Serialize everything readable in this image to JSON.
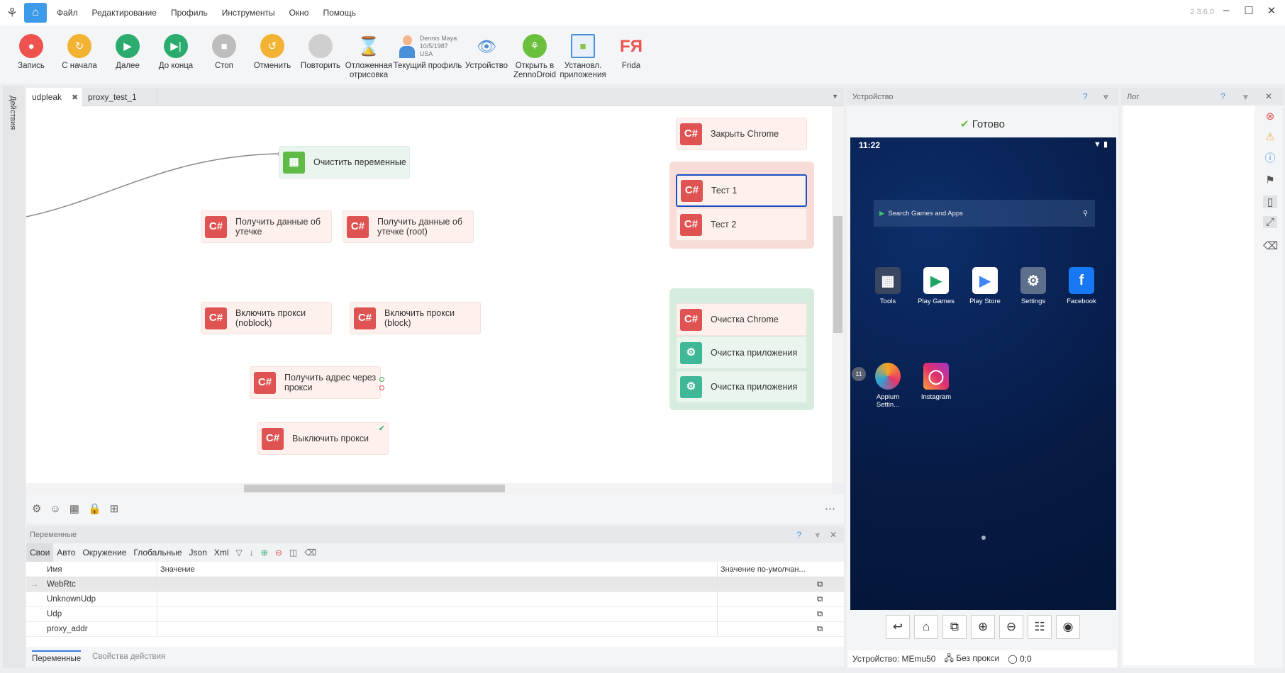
{
  "app": {
    "version": "2.3.6.0"
  },
  "menu": [
    "Файл",
    "Редактирование",
    "Профиль",
    "Инструменты",
    "Окно",
    "Помощь"
  ],
  "toolbar": [
    {
      "label": "Запись",
      "icon": "record-icon",
      "color": "#ef5350"
    },
    {
      "label": "С начала",
      "icon": "restart-icon",
      "color": "#f2b233"
    },
    {
      "label": "Далее",
      "icon": "play-icon",
      "color": "#2bab6e"
    },
    {
      "label": "До конца",
      "icon": "play-to-end-icon",
      "color": "#2bab6e"
    },
    {
      "label": "Стоп",
      "icon": "stop-icon",
      "color": "#bdbdbd"
    },
    {
      "label": "Отменить",
      "icon": "undo-icon",
      "color": "#f2b233"
    },
    {
      "label": "Повторить",
      "icon": "redo-icon",
      "color": "#cfcfcf"
    },
    {
      "label": "Отложенная отрисовка",
      "icon": "hourglass-icon",
      "color": "#b07a3c"
    },
    {
      "label": "Устройство",
      "icon": "eye-icon",
      "color": "#4a90d9"
    },
    {
      "label": "Открыть в ZennoDroid",
      "icon": "zennodroid-icon",
      "color": "#6abf3c"
    },
    {
      "label": "Установл. приложения",
      "icon": "installed-apps-icon",
      "color": "#4a90d9"
    },
    {
      "label": "Frida",
      "icon": "frida-logo",
      "color": "#ef5350"
    }
  ],
  "profile": {
    "label": "Текущий профиль",
    "name": "Dennis Maya",
    "dob": "10/5/1987",
    "country": "USA"
  },
  "side_strip": "Действия",
  "tabs": [
    {
      "label": "udpleak",
      "active": true
    },
    {
      "label": "proxy_test_1",
      "active": false
    }
  ],
  "nodes": {
    "clear_vars": "Очистить переменные",
    "leak": "Получить данные об утечке",
    "leak_root": "Получить данные об утечке (root)",
    "proxy_noblock": "Включить прокси (noblock)",
    "proxy_block": "Включить прокси (block)",
    "get_addr": "Получить адрес через прокси",
    "proxy_off": "Выключить прокси",
    "close_chrome": "Закрыть Chrome",
    "test1": "Тест 1",
    "test2": "Тест 2",
    "clear_chrome": "Очистка Chrome",
    "clear_app1": "Очистка приложения",
    "clear_app2": "Очистка приложения",
    "cs_label": "C#"
  },
  "variables": {
    "title": "Переменные",
    "tabs": [
      "Свои",
      "Авто",
      "Окружение",
      "Глобальные",
      "Json",
      "Xml"
    ],
    "columns": [
      "Имя",
      "Значение",
      "Значение по-умолчан..."
    ],
    "rows": [
      {
        "name": "WebRtc",
        "value": ""
      },
      {
        "name": "UnknownUdp",
        "value": ""
      },
      {
        "name": "Udp",
        "value": ""
      },
      {
        "name": "proxy_addr",
        "value": ""
      }
    ]
  },
  "bottom_tabs": [
    "Переменные",
    "Свойства действия"
  ],
  "device": {
    "title": "Устройство",
    "status": "Готово",
    "time": "11:22",
    "search_placeholder": "Search Games and Apps",
    "apps": [
      "Tools",
      "Play Games",
      "Play Store",
      "Settings",
      "Facebook",
      "Appium Settin...",
      "Instagram"
    ],
    "badge": "11",
    "footer_device": "Устройство: MEmu50",
    "footer_proxy": "Без прокси",
    "footer_coords": "0;0"
  },
  "log": {
    "title": "Лог"
  },
  "help": "?"
}
